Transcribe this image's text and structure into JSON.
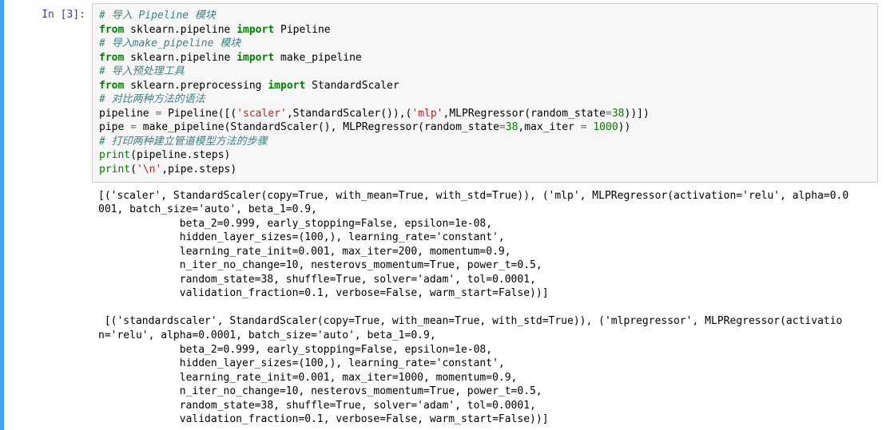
{
  "prompt": "In [3]:",
  "code": {
    "c1": "# 导入 Pipeline 模块",
    "l2_from": "from",
    "l2_mod": "sklearn.pipeline",
    "l2_imp": "import",
    "l2_name": "Pipeline",
    "c3": "# 导入make_pipeline 模块",
    "l4_from": "from",
    "l4_mod": "sklearn.pipeline",
    "l4_imp": "import",
    "l4_name": "make_pipeline",
    "c5": "# 导入预处理工具",
    "l6_from": "from",
    "l6_mod": "sklearn.preprocessing",
    "l6_imp": "import",
    "l6_name": "StandardScaler",
    "c7": "# 对比两种方法的语法",
    "l8a": "pipeline ",
    "l8op1": "=",
    "l8b": " Pipeline([(",
    "l8s1": "'scaler'",
    "l8c": ",StandardScaler()),(",
    "l8s2": "'mlp'",
    "l8d": ",MLPRegressor(random_state",
    "l8op2": "=",
    "l8n1": "38",
    "l8e": "))])",
    "l9a": "pipe ",
    "l9op1": "=",
    "l9b": " make_pipeline(StandardScaler(), MLPRegressor(random_state",
    "l9op2": "=",
    "l9n1": "38",
    "l9c": ",max_iter ",
    "l9op3": "=",
    "l9n2": " 1000",
    "l9d": "))",
    "c10": "# 打印两种建立管道模型方法的步骤",
    "l11_print": "print",
    "l11_rest": "(pipeline.steps)",
    "l12_print": "print",
    "l12a": "(",
    "l12s": "'\\n'",
    "l12b": ",pipe.steps)"
  },
  "output": "[('scaler', StandardScaler(copy=True, with_mean=True, with_std=True)), ('mlp', MLPRegressor(activation='relu', alpha=0.0\n001, batch_size='auto', beta_1=0.9,\n             beta_2=0.999, early_stopping=False, epsilon=1e-08,\n             hidden_layer_sizes=(100,), learning_rate='constant',\n             learning_rate_init=0.001, max_iter=200, momentum=0.9,\n             n_iter_no_change=10, nesterovs_momentum=True, power_t=0.5,\n             random_state=38, shuffle=True, solver='adam', tol=0.0001,\n             validation_fraction=0.1, verbose=False, warm_start=False))]\n\n [('standardscaler', StandardScaler(copy=True, with_mean=True, with_std=True)), ('mlpregressor', MLPRegressor(activatio\nn='relu', alpha=0.0001, batch_size='auto', beta_1=0.9,\n             beta_2=0.999, early_stopping=False, epsilon=1e-08,\n             hidden_layer_sizes=(100,), learning_rate='constant',\n             learning_rate_init=0.001, max_iter=1000, momentum=0.9,\n             n_iter_no_change=10, nesterovs_momentum=True, power_t=0.5,\n             random_state=38, shuffle=True, solver='adam', tol=0.0001,\n             validation_fraction=0.1, verbose=False, warm_start=False))]"
}
